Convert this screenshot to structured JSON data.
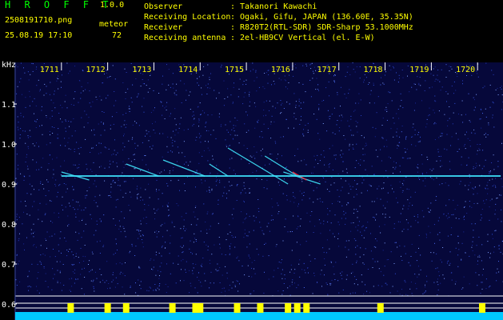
{
  "header": {
    "app_title": "H R O F F T",
    "app_version": "1.0.0",
    "file_name": "2508191710.png",
    "mode_label": "meteor",
    "datetime": "25.08.19 17:10",
    "count": "72",
    "info": [
      {
        "label": "Observer",
        "value": ": Takanori Kawachi"
      },
      {
        "label": "Receiving Location",
        "value": ": Ogaki, Gifu, JAPAN (136.60E, 35.35N)"
      },
      {
        "label": "Receiver",
        "value": ": R820T2(RTL-SDR) SDR-Sharp 53.1000MHz"
      },
      {
        "label": "Receiving antenna",
        "value": ": 2el-HB9CV Vertical (el. E-W)"
      }
    ]
  },
  "axis": {
    "unit": "kHz",
    "time_ticks": [
      "1711",
      "1712",
      "1713",
      "1714",
      "1715",
      "1716",
      "1717",
      "1718",
      "1719",
      "1720"
    ],
    "freq_ticks": [
      "1.1",
      "1.0",
      "0.9",
      "0.8",
      "0.7",
      "0.6"
    ]
  },
  "colors": {
    "background": "#000000",
    "plot_background": "#06083a",
    "title_green": "#00ff00",
    "text_yellow": "#ffff00",
    "carrier_cyan": "#40e8ff",
    "baseline_cyan": "#00c8ff",
    "frame_white": "#ffffff"
  },
  "chart_data": {
    "type": "heatmap",
    "x_ticks": [
      "1711",
      "1712",
      "1713",
      "1714",
      "1715",
      "1716",
      "1717",
      "1718",
      "1719",
      "1720"
    ],
    "y_ticks": [
      1.1,
      1.0,
      0.9,
      0.8,
      0.7,
      0.6
    ],
    "ylabel": "kHz",
    "carrier_khz": 0.92,
    "carrier_x_range": [
      1711.0,
      1720.5
    ],
    "echo_traces": [
      {
        "x1": 1711.0,
        "y1": 0.93,
        "x2": 1711.6,
        "y2": 0.91,
        "color": "#40e8ff"
      },
      {
        "x1": 1712.4,
        "y1": 0.95,
        "x2": 1713.1,
        "y2": 0.92,
        "color": "#40e8ff"
      },
      {
        "x1": 1713.2,
        "y1": 0.96,
        "x2": 1714.1,
        "y2": 0.92,
        "color": "#40e8ff"
      },
      {
        "x1": 1714.2,
        "y1": 0.95,
        "x2": 1714.6,
        "y2": 0.92,
        "color": "#40e8ff"
      },
      {
        "x1": 1714.6,
        "y1": 0.99,
        "x2": 1715.9,
        "y2": 0.9,
        "color": "#40e8ff"
      },
      {
        "x1": 1715.4,
        "y1": 0.97,
        "x2": 1716.1,
        "y2": 0.92,
        "color": "#40e8ff"
      },
      {
        "x1": 1715.8,
        "y1": 0.93,
        "x2": 1716.6,
        "y2": 0.9,
        "color": "#40e8ff"
      },
      {
        "x1": 1716.0,
        "y1": 0.93,
        "x2": 1716.3,
        "y2": 0.91,
        "color": "#ff3040"
      }
    ],
    "baseline_bars_x": [
      1711.2,
      1712.0,
      1712.4,
      1713.4,
      1713.9,
      1714.0,
      1714.8,
      1715.3,
      1715.9,
      1716.1,
      1716.3,
      1717.9,
      1720.1
    ]
  }
}
